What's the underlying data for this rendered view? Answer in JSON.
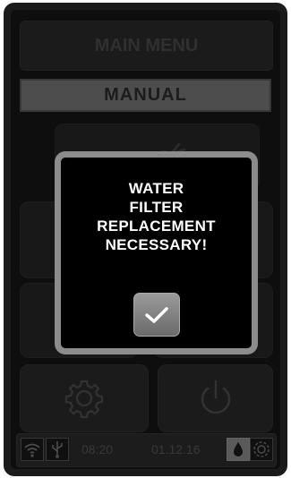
{
  "header": {
    "title": "MAIN MENU"
  },
  "mode": {
    "label": "MANUAL"
  },
  "dialog": {
    "message": "WATER\nFILTER\nREPLACEMENT\nNECESSARY!",
    "confirm_icon": "checkmark-icon"
  },
  "tiles": [
    {
      "icon": "hand-icon"
    },
    {
      "icon": "unknown"
    },
    {
      "icon": "unknown"
    },
    {
      "icon": "gear-icon"
    },
    {
      "icon": "power-icon"
    }
  ],
  "statusbar": {
    "time": "08:20",
    "date": "01.12.16",
    "icons": [
      "wifi-icon",
      "usb-icon",
      "water-drop-icon",
      "gear-icon"
    ]
  },
  "colors": {
    "dialog_border": "#8c8c8c",
    "dialog_text": "#ffffff",
    "background": "#161616"
  }
}
